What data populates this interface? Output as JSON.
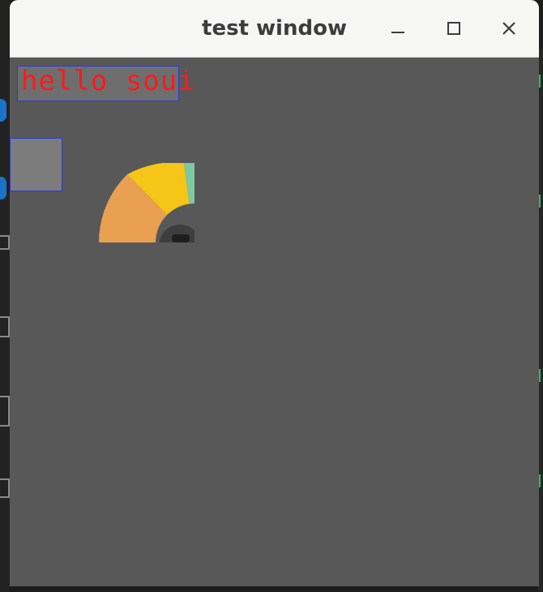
{
  "window": {
    "title": "test window"
  },
  "content": {
    "label_text": "hello soui"
  },
  "icons": {
    "minimize": "minimize-icon",
    "maximize": "maximize-icon",
    "close": "close-icon"
  },
  "colors": {
    "window_bg": "#585858",
    "titlebar_bg": "#f6f6f5",
    "label_text": "#ff1a1a",
    "box_border": "#2a3ad6",
    "gauge_orange": "#e9a050",
    "gauge_yellow": "#f5c518",
    "gauge_green": "#7cc9a2"
  }
}
